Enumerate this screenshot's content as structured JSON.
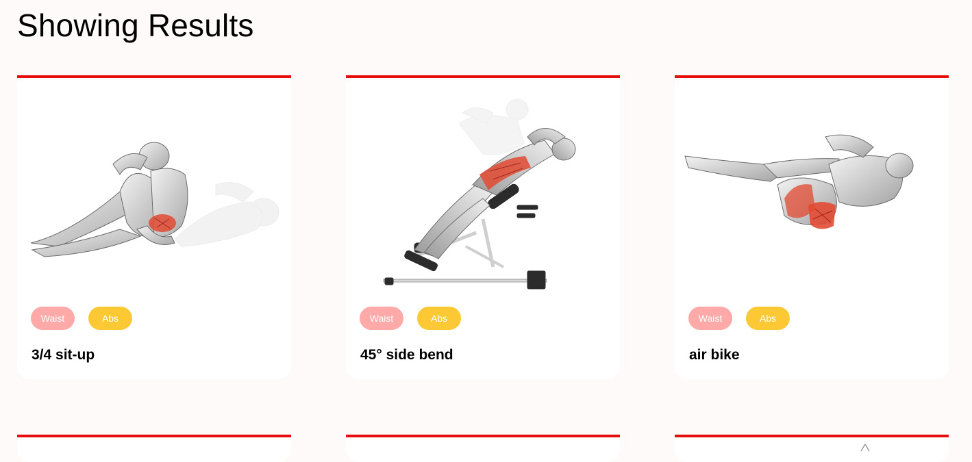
{
  "page": {
    "title": "Showing Results"
  },
  "colors": {
    "accent_red": "#e60d0d",
    "waist_tag": "#ffa9a9",
    "abs_tag": "#fcc934",
    "page_background": "#fffafa",
    "card_background": "#ffffff"
  },
  "results": [
    {
      "name": "3/4 sit-up",
      "image_icon": "sit-up-illustration",
      "tags": [
        {
          "label": "Waist",
          "color": "#ffa9a9"
        },
        {
          "label": "Abs",
          "color": "#fcc934"
        }
      ]
    },
    {
      "name": "45° side bend",
      "image_icon": "side-bend-illustration",
      "tags": [
        {
          "label": "Waist",
          "color": "#ffa9a9"
        },
        {
          "label": "Abs",
          "color": "#fcc934"
        }
      ]
    },
    {
      "name": "air bike",
      "image_icon": "air-bike-illustration",
      "tags": [
        {
          "label": "Waist",
          "color": "#ffa9a9"
        },
        {
          "label": "Abs",
          "color": "#fcc934"
        }
      ]
    }
  ]
}
